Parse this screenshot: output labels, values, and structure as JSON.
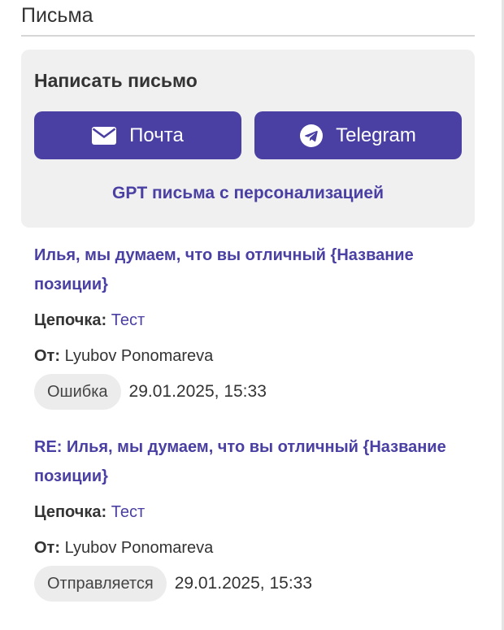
{
  "section": {
    "title": "Письма"
  },
  "compose": {
    "title": "Написать письмо",
    "mail_button": {
      "label": "Почта",
      "icon": "envelope-icon"
    },
    "telegram_button": {
      "label": "Telegram",
      "icon": "telegram-icon"
    },
    "gpt_link": "GPT письма с персонализацией"
  },
  "letters": [
    {
      "subject": "Илья, мы думаем, что вы отличный {Название позиции}",
      "chain_label": "Цепочка:",
      "chain_value": "Тест",
      "from_label": "От:",
      "from_value": "Lyubov Ponomareva",
      "status": "Ошибка",
      "datetime": "29.01.2025, 15:33"
    },
    {
      "subject": "RE: Илья, мы думаем, что вы отличный {Название позиции}",
      "chain_label": "Цепочка:",
      "chain_value": "Тест",
      "from_label": "От:",
      "from_value": "Lyubov Ponomareva",
      "status": "Отправляется",
      "datetime": "29.01.2025, 15:33"
    }
  ],
  "colors": {
    "accent": "#4a40a3",
    "card_bg": "#f0f0f0",
    "badge_bg": "#ececec",
    "text": "#333333"
  }
}
